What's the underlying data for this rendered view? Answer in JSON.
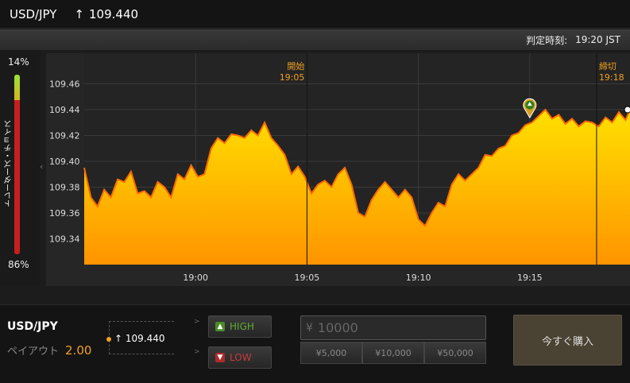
{
  "header": {
    "pair": "USD/JPY",
    "arrow": "↑",
    "rate": "109.440"
  },
  "subheader": {
    "judgement_label": "判定時刻:",
    "judgement_time": "19:20 JST"
  },
  "sentiment": {
    "top_percent": "14%",
    "bottom_percent": "86%",
    "vertical_label": "トレーダーズ・チョイス",
    "high_fraction": 0.14,
    "colors": {
      "high": "#9be23a",
      "low": "#c81e1e"
    }
  },
  "chart_data": {
    "type": "area",
    "y_ticks": [
      "109.46",
      "109.44",
      "109.42",
      "109.40",
      "109.38",
      "109.36",
      "109.34"
    ],
    "ylim": [
      109.32,
      109.48
    ],
    "x_ticks": [
      "19:00",
      "19:05",
      "19:10",
      "19:15"
    ],
    "xlim_minutes": [
      -5,
      19.5
    ],
    "open_label": "開始",
    "open_time": "19:05",
    "close_label": "締切",
    "close_time": "19:18",
    "open_minute": 5,
    "close_minute": 18,
    "entry_minute": 15,
    "entry_value": 109.435,
    "series": [
      {
        "x": [
          -5,
          -4.7,
          -4.4,
          -4.1,
          -3.8,
          -3.5,
          -3.2,
          -2.9,
          -2.6,
          -2.3,
          -2.0,
          -1.7,
          -1.4,
          -1.1,
          -0.8,
          -0.5,
          -0.2,
          0.1,
          0.4,
          0.7,
          1.0,
          1.3,
          1.6,
          1.9,
          2.2,
          2.5,
          2.8,
          3.1,
          3.4,
          3.7,
          4.0,
          4.3,
          4.6,
          4.9,
          5.2,
          5.5,
          5.8,
          6.1,
          6.4,
          6.7,
          7.0,
          7.3,
          7.6,
          7.9,
          8.2,
          8.5,
          8.8,
          9.1,
          9.4,
          9.7,
          10.0,
          10.3,
          10.6,
          10.9,
          11.2,
          11.5,
          11.8,
          12.1,
          12.4,
          12.7,
          13.0,
          13.3,
          13.6,
          13.9,
          14.2,
          14.5,
          14.8,
          15.1,
          15.4,
          15.7,
          16.0,
          16.3,
          16.6,
          16.9,
          17.2,
          17.5,
          17.8,
          18.1,
          18.4,
          18.7,
          19.0,
          19.3,
          19.5
        ],
        "y": [
          109.395,
          109.372,
          109.365,
          109.378,
          109.372,
          109.386,
          109.384,
          109.392,
          109.375,
          109.377,
          109.372,
          109.384,
          109.38,
          109.372,
          109.39,
          109.386,
          109.397,
          109.388,
          109.39,
          109.41,
          109.418,
          109.414,
          109.421,
          109.42,
          109.418,
          109.424,
          109.42,
          109.43,
          109.418,
          109.412,
          109.405,
          109.39,
          109.396,
          109.388,
          109.375,
          109.382,
          109.385,
          109.38,
          109.39,
          109.395,
          109.382,
          109.36,
          109.357,
          109.37,
          109.378,
          109.384,
          109.378,
          109.372,
          109.378,
          109.372,
          109.355,
          109.35,
          109.36,
          109.368,
          109.365,
          109.382,
          109.39,
          109.385,
          109.39,
          109.395,
          109.405,
          109.404,
          109.41,
          109.412,
          109.42,
          109.422,
          109.428,
          109.43,
          109.435,
          109.44,
          109.433,
          109.436,
          109.429,
          109.433,
          109.427,
          109.431,
          109.43,
          109.427,
          109.434,
          109.43,
          109.438,
          109.432,
          109.44
        ]
      }
    ],
    "colors": {
      "fill_top": "#ffe000",
      "fill_bottom": "#ff9400",
      "line": "#ff6a00",
      "grid": "#3a3a3a",
      "marker": "#d8a020"
    }
  },
  "bottom": {
    "pair": "USD/JPY",
    "payout_label": "ペイアウト",
    "payout_value": "2.00",
    "current_arrow": "↑",
    "current_rate": "109.440",
    "gt": ">",
    "high_label": "HIGH",
    "low_label": "LOW",
    "amount_yen": "¥",
    "amount_placeholder": "10000",
    "quick1": "¥5,000",
    "quick2": "¥10,000",
    "quick3": "¥50,000",
    "buy_label": "今すぐ購入"
  }
}
